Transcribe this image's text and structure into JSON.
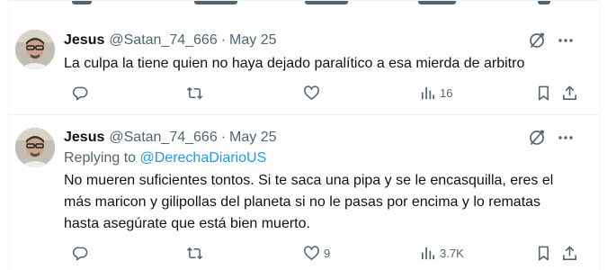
{
  "tweets": [
    {
      "name": "Jesus",
      "handle": "@Satan_74_666",
      "separator": "·",
      "date": "May 25",
      "text": "La culpa la tiene quien no haya dejado paralítico a esa mierda de arbitro",
      "replying_prefix": "",
      "replying_to": "",
      "replies": "",
      "reposts": "",
      "likes": "",
      "views": "16"
    },
    {
      "name": "Jesus",
      "handle": "@Satan_74_666",
      "separator": "·",
      "date": "May 25",
      "replying_prefix": "Replying to ",
      "replying_to": "@DerechaDiarioUS",
      "text": "No mueren suficientes tontos. Si te saca una pipa y se le encasquilla, eres el más maricon y gilipollas del planeta si no le pasas por encima y lo rematas hasta asegúrate que está bien muerto.",
      "replies": "",
      "reposts": "",
      "likes": "9",
      "views": "3.7K"
    }
  ],
  "icons": {
    "reply": "reply-icon",
    "repost": "repost-icon",
    "like": "heart-icon",
    "views": "views-icon",
    "bookmark": "bookmark-icon",
    "share": "share-icon",
    "grok": "grok-icon",
    "more": "more-icon"
  },
  "colors": {
    "text": "#0f1419",
    "secondary": "#536471",
    "accent": "#1d9bf0",
    "border": "#eff3f4"
  }
}
